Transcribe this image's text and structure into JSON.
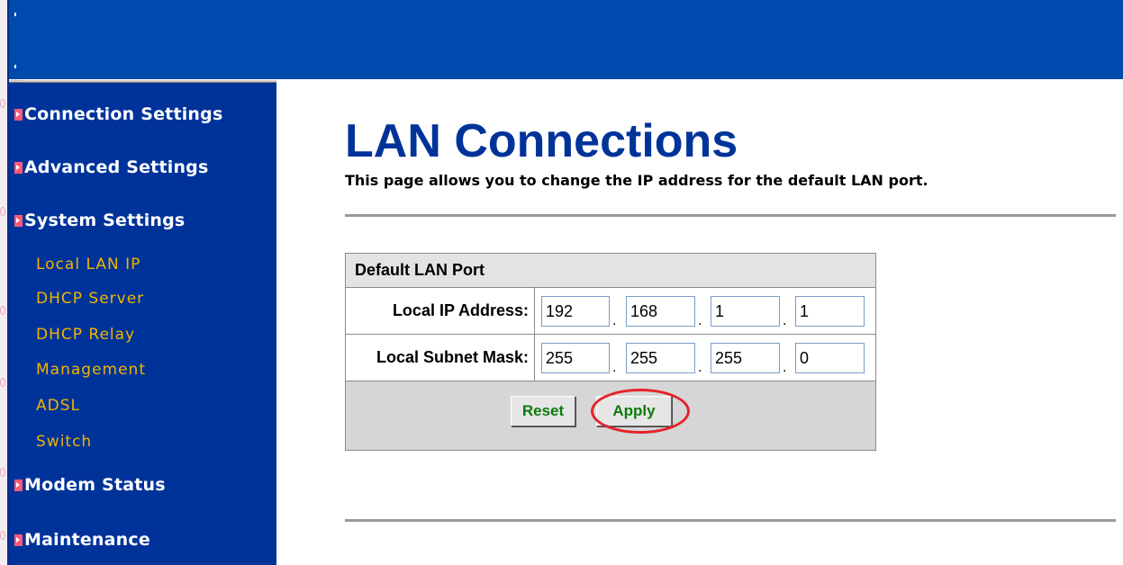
{
  "sidebar": {
    "categories": [
      {
        "label": "Connection Settings"
      },
      {
        "label": "Advanced Settings"
      },
      {
        "label": "System Settings"
      },
      {
        "label": "Modem Status"
      },
      {
        "label": "Maintenance"
      }
    ],
    "system_settings_items": [
      {
        "label": "Local LAN IP"
      },
      {
        "label": "DHCP Server"
      },
      {
        "label": "DHCP Relay"
      },
      {
        "label": "Management"
      },
      {
        "label": "ADSL"
      },
      {
        "label": "Switch"
      }
    ]
  },
  "page": {
    "title": "LAN Connections",
    "description": "This page allows you to change the IP address for the default LAN port."
  },
  "panel": {
    "header": "Default LAN Port",
    "rows": [
      {
        "label": "Local IP Address:",
        "octets": [
          "192",
          "168",
          "1",
          "1"
        ],
        "separator": "."
      },
      {
        "label": "Local Subnet Mask:",
        "octets": [
          "255",
          "255",
          "255",
          "0"
        ],
        "separator": "."
      }
    ],
    "reset_label": "Reset",
    "apply_label": "Apply"
  },
  "colors": {
    "topbar": "#0049ad",
    "sidebar": "#00339a",
    "title": "#003399",
    "submenu_text": "#f0b400",
    "button_text": "#0b7a0b",
    "highlight": "#e5222a"
  },
  "icons": {
    "category_bullet": "arrow-right-icon"
  }
}
